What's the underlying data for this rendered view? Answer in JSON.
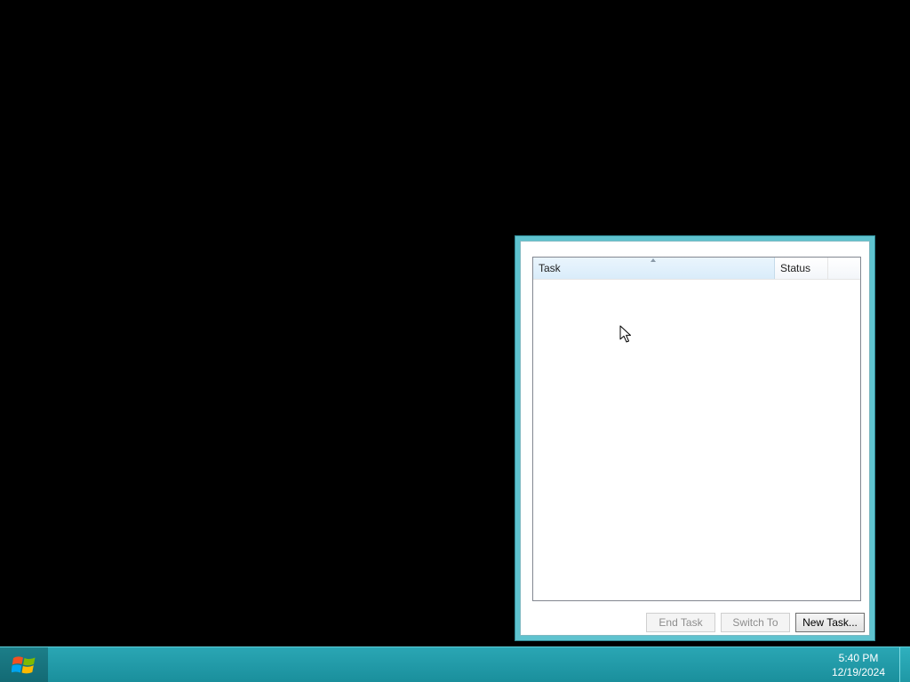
{
  "taskmanager": {
    "columns": [
      {
        "label": "Task"
      },
      {
        "label": "Status"
      }
    ],
    "rows": [],
    "buttons": {
      "end_task": "End Task",
      "switch_to": "Switch To",
      "new_task": "New Task..."
    },
    "button_states": {
      "end_task": "disabled",
      "switch_to": "disabled",
      "new_task": "enabled"
    }
  },
  "taskbar": {
    "start_icon": "windows-logo-icon",
    "clock": {
      "time": "5:40 PM",
      "date": "12/19/2024"
    }
  },
  "colors": {
    "window_frame": "#5fc3cf",
    "taskbar": "#1a8f9c",
    "desktop": "#000000"
  }
}
